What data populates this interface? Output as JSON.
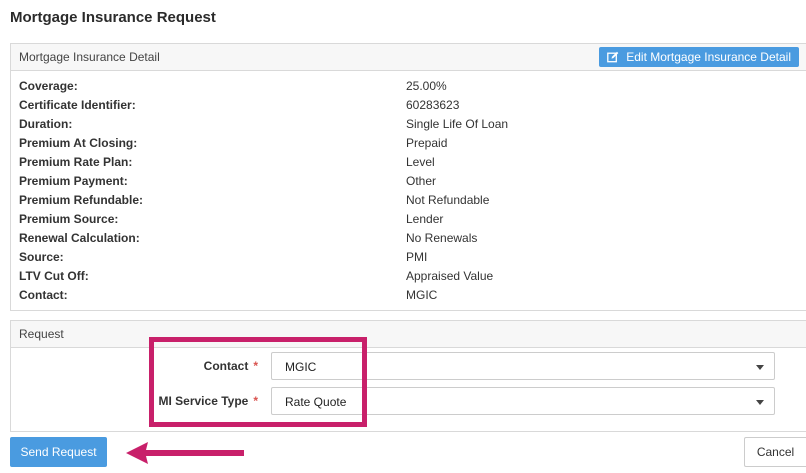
{
  "page": {
    "title": "Mortgage Insurance Request"
  },
  "detail_panel": {
    "header": "Mortgage Insurance Detail",
    "edit_button_label": "Edit Mortgage Insurance Detail",
    "rows": [
      {
        "label": "Coverage:",
        "value": "25.00%"
      },
      {
        "label": "Certificate Identifier:",
        "value": "60283623"
      },
      {
        "label": "Duration:",
        "value": "Single Life Of Loan"
      },
      {
        "label": "Premium At Closing:",
        "value": "Prepaid"
      },
      {
        "label": "Premium Rate Plan:",
        "value": "Level"
      },
      {
        "label": "Premium Payment:",
        "value": "Other"
      },
      {
        "label": "Premium Refundable:",
        "value": "Not Refundable"
      },
      {
        "label": "Premium Source:",
        "value": "Lender"
      },
      {
        "label": "Renewal Calculation:",
        "value": "No Renewals"
      },
      {
        "label": "Source:",
        "value": "PMI"
      },
      {
        "label": "LTV Cut Off:",
        "value": "Appraised Value"
      },
      {
        "label": "Contact:",
        "value": "MGIC"
      }
    ]
  },
  "request_panel": {
    "header": "Request",
    "contact": {
      "label": "Contact",
      "required_marker": "*",
      "selected": "MGIC"
    },
    "service_type": {
      "label": "MI Service Type",
      "required_marker": "*",
      "selected": "Rate Quote"
    }
  },
  "actions": {
    "send_label": "Send Request",
    "cancel_label": "Cancel"
  },
  "annotation": {
    "highlight_color": "#c8206a"
  },
  "colors": {
    "accent": "#4a9be0",
    "required": "#d9534f"
  },
  "icons": {
    "edit": "edit-square-icon",
    "dropdown": "caret-down-icon",
    "arrow": "arrow-left-icon"
  }
}
